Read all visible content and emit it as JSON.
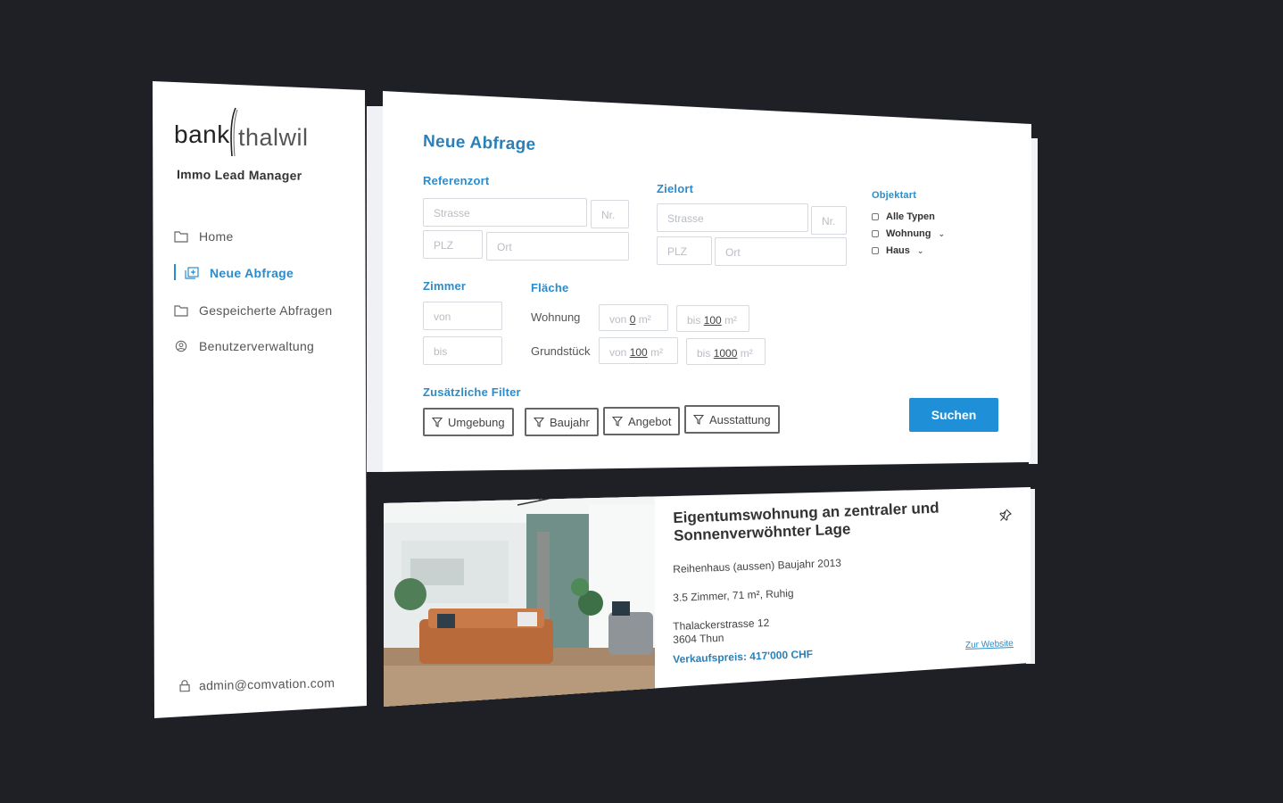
{
  "brand": {
    "logo_left": "bank",
    "logo_right": "thalwil",
    "app_name": "Immo Lead Manager"
  },
  "sidebar": {
    "items": [
      {
        "label": "Home",
        "icon": "folder-icon"
      },
      {
        "label": "Neue Abfrage",
        "icon": "add-query-icon"
      },
      {
        "label": "Gespeicherte Abfragen",
        "icon": "folder-icon"
      },
      {
        "label": "Benutzerverwaltung",
        "icon": "user-circle-icon"
      }
    ],
    "active_item": "Neue Abfrage",
    "user_email": "admin@comvation.com"
  },
  "query": {
    "title": "Neue Abfrage",
    "referenzort": {
      "label": "Referenzort",
      "strasse_placeholder": "Strasse",
      "nr_placeholder": "Nr.",
      "plz_placeholder": "PLZ",
      "ort_placeholder": "Ort"
    },
    "zielort": {
      "label": "Zielort",
      "strasse_placeholder": "Strasse",
      "nr_placeholder": "Nr.",
      "plz_placeholder": "PLZ",
      "ort_placeholder": "Ort"
    },
    "objektart": {
      "label": "Objektart",
      "options": [
        "Alle Typen",
        "Wohnung",
        "Haus"
      ]
    },
    "zimmer": {
      "label": "Zimmer",
      "von_placeholder": "von",
      "bis_placeholder": "bis"
    },
    "flaeche": {
      "label": "Fläche",
      "wohnung_label": "Wohnung",
      "grundstueck_label": "Grundstück",
      "von_text": "von",
      "bis_text": "bis",
      "unit": "m²",
      "wohnung_von": "0",
      "wohnung_bis": "100",
      "grundstueck_von": "100",
      "grundstueck_bis": "1000"
    },
    "filters": {
      "label": "Zusätzliche Filter",
      "buttons": [
        "Umgebung",
        "Baujahr",
        "Angebot",
        "Ausstattung"
      ]
    },
    "search_label": "Suchen"
  },
  "result": {
    "title": "Eigentumswohnung an zentraler und Sonnenverwöhnter Lage",
    "type_line": "Reihenhaus (aussen) Baujahr 2013",
    "details_line": "3.5 Zimmer, 71 m², Ruhig",
    "street": "Thalackerstrasse 12",
    "city": "3604 Thun",
    "price": "Verkaufspreis: 417'000 CHF",
    "link_label": "Zur Website"
  },
  "colors": {
    "accent": "#2b8ccb",
    "button": "#1f8fd8",
    "background": "#1e2026"
  }
}
